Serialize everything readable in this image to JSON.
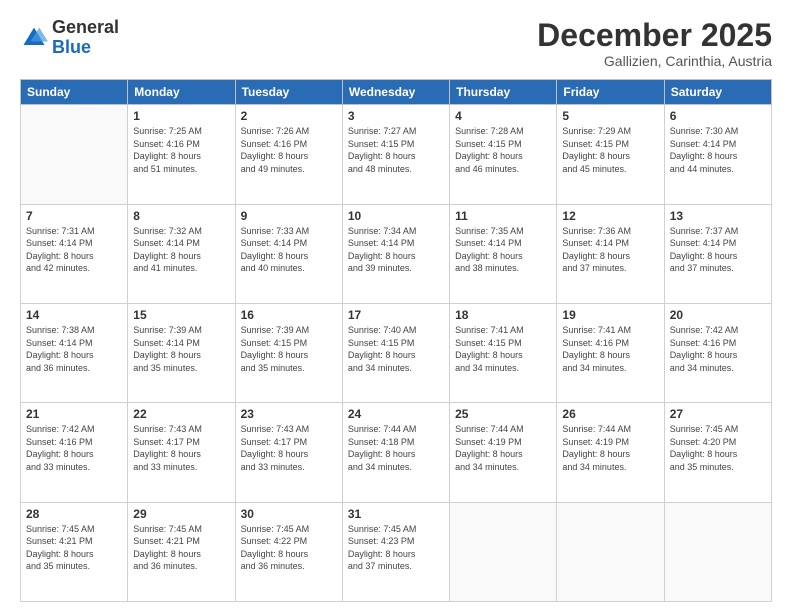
{
  "logo": {
    "general": "General",
    "blue": "Blue"
  },
  "header": {
    "month": "December 2025",
    "location": "Gallizien, Carinthia, Austria"
  },
  "weekdays": [
    "Sunday",
    "Monday",
    "Tuesday",
    "Wednesday",
    "Thursday",
    "Friday",
    "Saturday"
  ],
  "weeks": [
    [
      {
        "day": "",
        "info": ""
      },
      {
        "day": "1",
        "info": "Sunrise: 7:25 AM\nSunset: 4:16 PM\nDaylight: 8 hours\nand 51 minutes."
      },
      {
        "day": "2",
        "info": "Sunrise: 7:26 AM\nSunset: 4:16 PM\nDaylight: 8 hours\nand 49 minutes."
      },
      {
        "day": "3",
        "info": "Sunrise: 7:27 AM\nSunset: 4:15 PM\nDaylight: 8 hours\nand 48 minutes."
      },
      {
        "day": "4",
        "info": "Sunrise: 7:28 AM\nSunset: 4:15 PM\nDaylight: 8 hours\nand 46 minutes."
      },
      {
        "day": "5",
        "info": "Sunrise: 7:29 AM\nSunset: 4:15 PM\nDaylight: 8 hours\nand 45 minutes."
      },
      {
        "day": "6",
        "info": "Sunrise: 7:30 AM\nSunset: 4:14 PM\nDaylight: 8 hours\nand 44 minutes."
      }
    ],
    [
      {
        "day": "7",
        "info": "Sunrise: 7:31 AM\nSunset: 4:14 PM\nDaylight: 8 hours\nand 42 minutes."
      },
      {
        "day": "8",
        "info": "Sunrise: 7:32 AM\nSunset: 4:14 PM\nDaylight: 8 hours\nand 41 minutes."
      },
      {
        "day": "9",
        "info": "Sunrise: 7:33 AM\nSunset: 4:14 PM\nDaylight: 8 hours\nand 40 minutes."
      },
      {
        "day": "10",
        "info": "Sunrise: 7:34 AM\nSunset: 4:14 PM\nDaylight: 8 hours\nand 39 minutes."
      },
      {
        "day": "11",
        "info": "Sunrise: 7:35 AM\nSunset: 4:14 PM\nDaylight: 8 hours\nand 38 minutes."
      },
      {
        "day": "12",
        "info": "Sunrise: 7:36 AM\nSunset: 4:14 PM\nDaylight: 8 hours\nand 37 minutes."
      },
      {
        "day": "13",
        "info": "Sunrise: 7:37 AM\nSunset: 4:14 PM\nDaylight: 8 hours\nand 37 minutes."
      }
    ],
    [
      {
        "day": "14",
        "info": "Sunrise: 7:38 AM\nSunset: 4:14 PM\nDaylight: 8 hours\nand 36 minutes."
      },
      {
        "day": "15",
        "info": "Sunrise: 7:39 AM\nSunset: 4:14 PM\nDaylight: 8 hours\nand 35 minutes."
      },
      {
        "day": "16",
        "info": "Sunrise: 7:39 AM\nSunset: 4:15 PM\nDaylight: 8 hours\nand 35 minutes."
      },
      {
        "day": "17",
        "info": "Sunrise: 7:40 AM\nSunset: 4:15 PM\nDaylight: 8 hours\nand 34 minutes."
      },
      {
        "day": "18",
        "info": "Sunrise: 7:41 AM\nSunset: 4:15 PM\nDaylight: 8 hours\nand 34 minutes."
      },
      {
        "day": "19",
        "info": "Sunrise: 7:41 AM\nSunset: 4:16 PM\nDaylight: 8 hours\nand 34 minutes."
      },
      {
        "day": "20",
        "info": "Sunrise: 7:42 AM\nSunset: 4:16 PM\nDaylight: 8 hours\nand 34 minutes."
      }
    ],
    [
      {
        "day": "21",
        "info": "Sunrise: 7:42 AM\nSunset: 4:16 PM\nDaylight: 8 hours\nand 33 minutes."
      },
      {
        "day": "22",
        "info": "Sunrise: 7:43 AM\nSunset: 4:17 PM\nDaylight: 8 hours\nand 33 minutes."
      },
      {
        "day": "23",
        "info": "Sunrise: 7:43 AM\nSunset: 4:17 PM\nDaylight: 8 hours\nand 33 minutes."
      },
      {
        "day": "24",
        "info": "Sunrise: 7:44 AM\nSunset: 4:18 PM\nDaylight: 8 hours\nand 34 minutes."
      },
      {
        "day": "25",
        "info": "Sunrise: 7:44 AM\nSunset: 4:19 PM\nDaylight: 8 hours\nand 34 minutes."
      },
      {
        "day": "26",
        "info": "Sunrise: 7:44 AM\nSunset: 4:19 PM\nDaylight: 8 hours\nand 34 minutes."
      },
      {
        "day": "27",
        "info": "Sunrise: 7:45 AM\nSunset: 4:20 PM\nDaylight: 8 hours\nand 35 minutes."
      }
    ],
    [
      {
        "day": "28",
        "info": "Sunrise: 7:45 AM\nSunset: 4:21 PM\nDaylight: 8 hours\nand 35 minutes."
      },
      {
        "day": "29",
        "info": "Sunrise: 7:45 AM\nSunset: 4:21 PM\nDaylight: 8 hours\nand 36 minutes."
      },
      {
        "day": "30",
        "info": "Sunrise: 7:45 AM\nSunset: 4:22 PM\nDaylight: 8 hours\nand 36 minutes."
      },
      {
        "day": "31",
        "info": "Sunrise: 7:45 AM\nSunset: 4:23 PM\nDaylight: 8 hours\nand 37 minutes."
      },
      {
        "day": "",
        "info": ""
      },
      {
        "day": "",
        "info": ""
      },
      {
        "day": "",
        "info": ""
      }
    ]
  ]
}
